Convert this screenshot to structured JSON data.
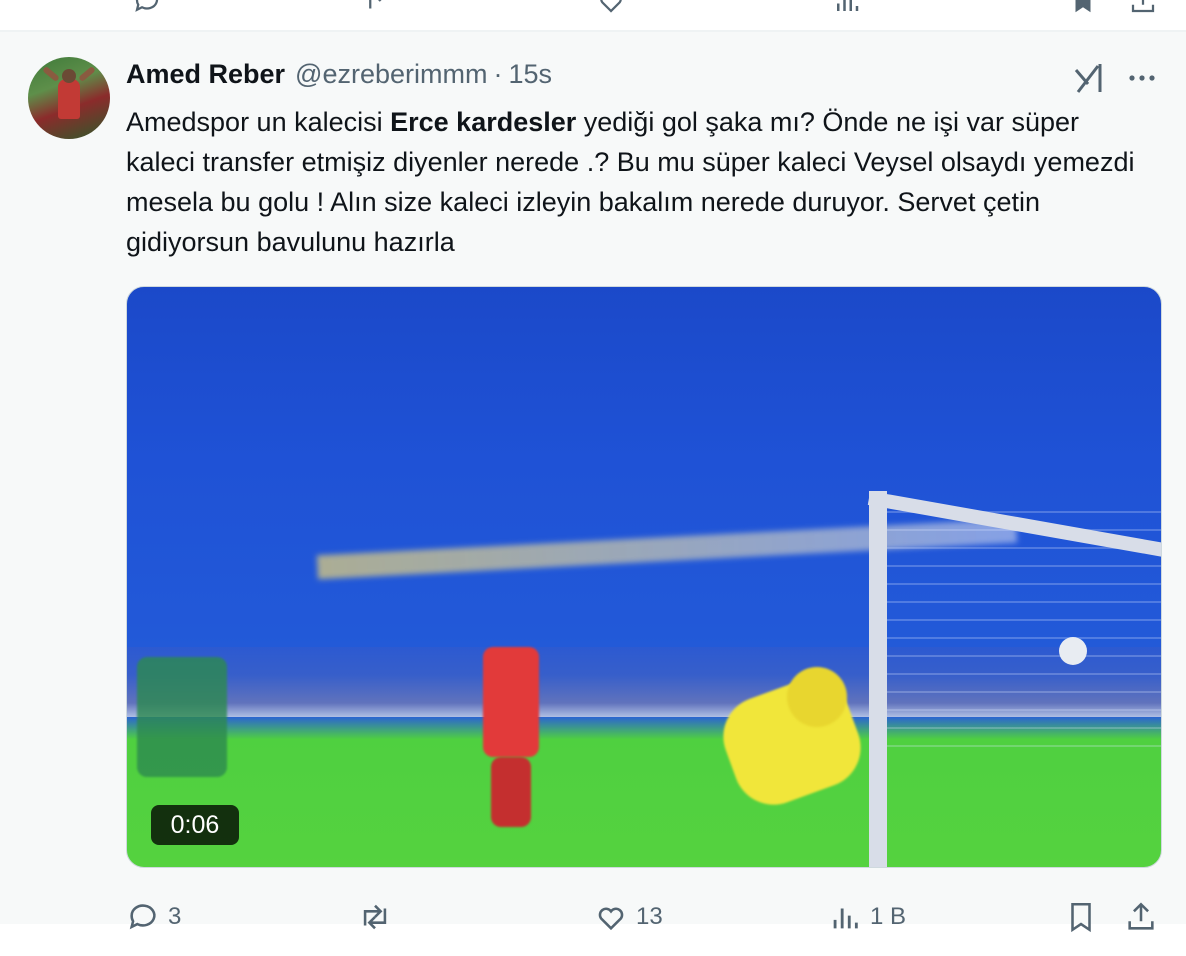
{
  "tweet": {
    "author_name": "Amed Reber",
    "handle": "@ezreberimmm",
    "separator": "·",
    "time": "15s",
    "text_part1": "Amedspor un kalecisi ",
    "text_bold": "Erce kardesler",
    "text_part2": " yediği gol şaka mı? Önde ne işi var süper kaleci transfer etmişiz diyenler nerede .? Bu mu süper kaleci Veysel olsaydı yemezdi mesela bu golu ! Alın size kaleci izleyin bakalım nerede duruyor. Servet çetin gidiyorsun bavulunu hazırla",
    "video_duration": "0:06"
  },
  "actions": {
    "replies": "3",
    "retweets": "",
    "likes": "13",
    "views": "1 B"
  },
  "icons": {
    "reply": "reply-icon",
    "retweet": "retweet-icon",
    "like": "heart-icon",
    "views": "views-icon",
    "bookmark": "bookmark-icon",
    "share": "share-icon",
    "grok": "grok-icon",
    "more": "more-icon"
  },
  "colors": {
    "text": "#0f1419",
    "secondary": "#536471",
    "background": "#f7f9f9"
  }
}
